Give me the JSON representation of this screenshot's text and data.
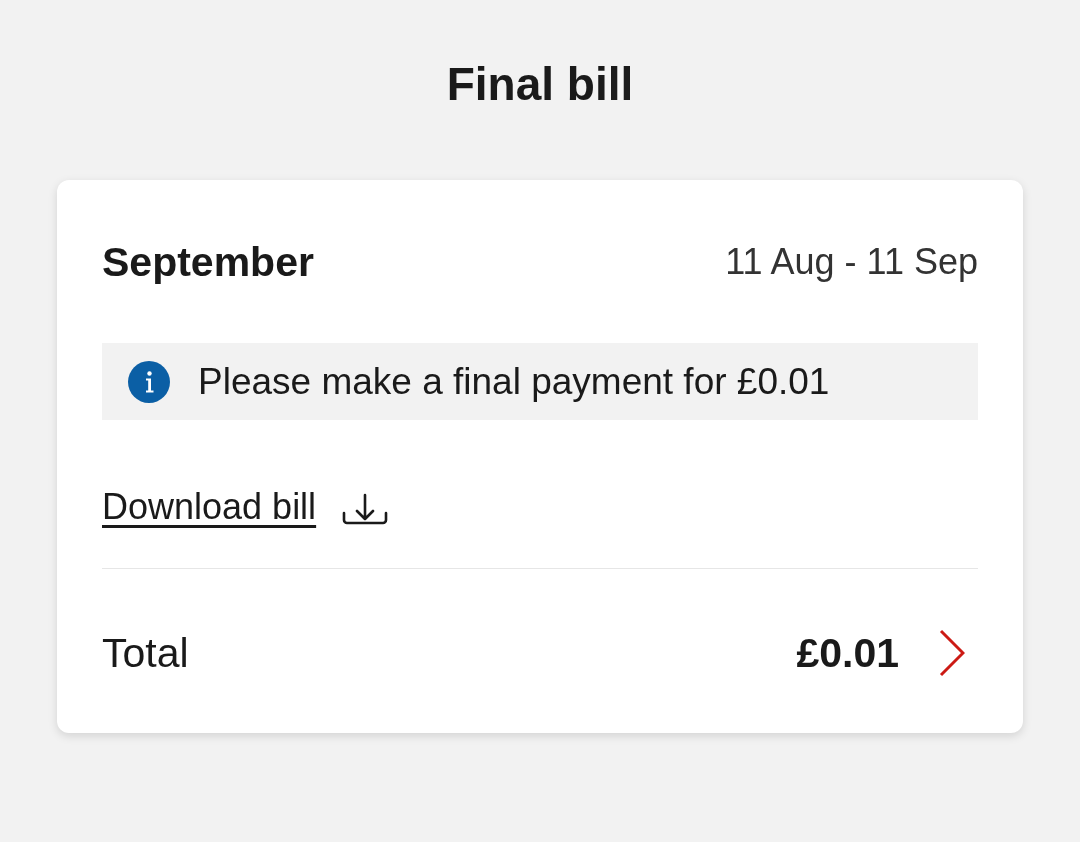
{
  "page": {
    "title": "Final bill"
  },
  "bill_card": {
    "month": "September",
    "period": "11 Aug - 11 Sep",
    "notice": {
      "kind": "info",
      "text": "Please make a final payment for £0.01"
    },
    "download_link": {
      "label": "Download bill"
    },
    "total": {
      "label": "Total",
      "amount": "£0.01"
    }
  }
}
